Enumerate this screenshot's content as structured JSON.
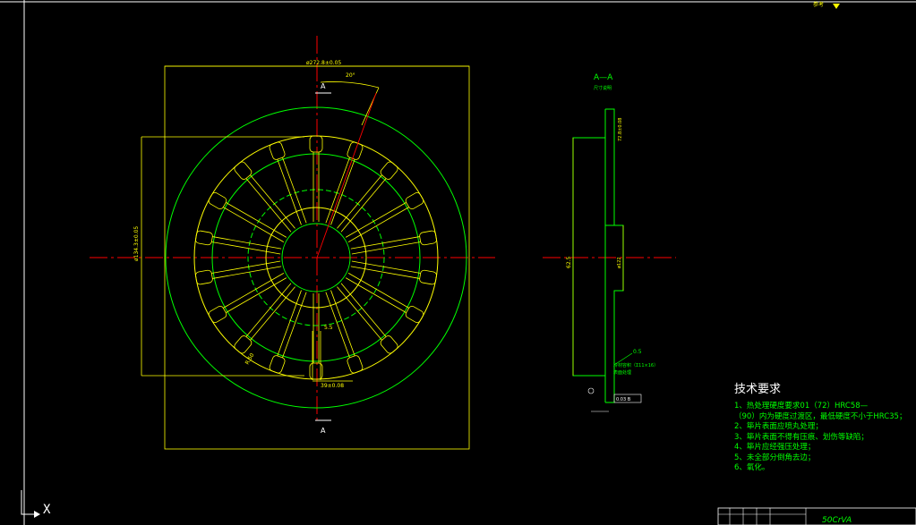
{
  "section": {
    "title": "A—A",
    "subtitle": "尺寸说明",
    "cut_top": "A",
    "cut_bottom": "A"
  },
  "dimensions": {
    "outer_diameter": "ø272.8±0.05",
    "inner_box": "ø134.3±0.05",
    "angle": "20°",
    "slot_width": "5.5",
    "radius_label": "R.50",
    "slot_length": "39±0.08",
    "section_thick": "72.8±0.08",
    "section_height": "62.5",
    "section_inner": "ø122",
    "roughness": "0.5",
    "weld_note": "冷材容积（Σ11×16）",
    "weld_note2": "表面处理",
    "flatness": "0.03 B"
  },
  "notes": {
    "title": "技术要求",
    "lines": [
      "1、热处理硬度要求01（72）HRC58—",
      "（90）内为硬度过渡区，最低硬度不小于HRC35；",
      "2、筚片表面应喷丸处理；",
      "3、筚片表面不得有压痕、划伤等缺陷；",
      "4、筚片应经强压处理；",
      "5、未全部分倒角去边；",
      "6、氧化。"
    ]
  },
  "title_block": {
    "material": "50CrVA"
  },
  "ucs": {
    "label": "X"
  },
  "corner": {
    "label": "参考"
  },
  "colors": {
    "background": "#000000",
    "green": "#00ff00",
    "yellow": "#ffff00",
    "red": "#ff0000",
    "white": "#ffffff"
  }
}
